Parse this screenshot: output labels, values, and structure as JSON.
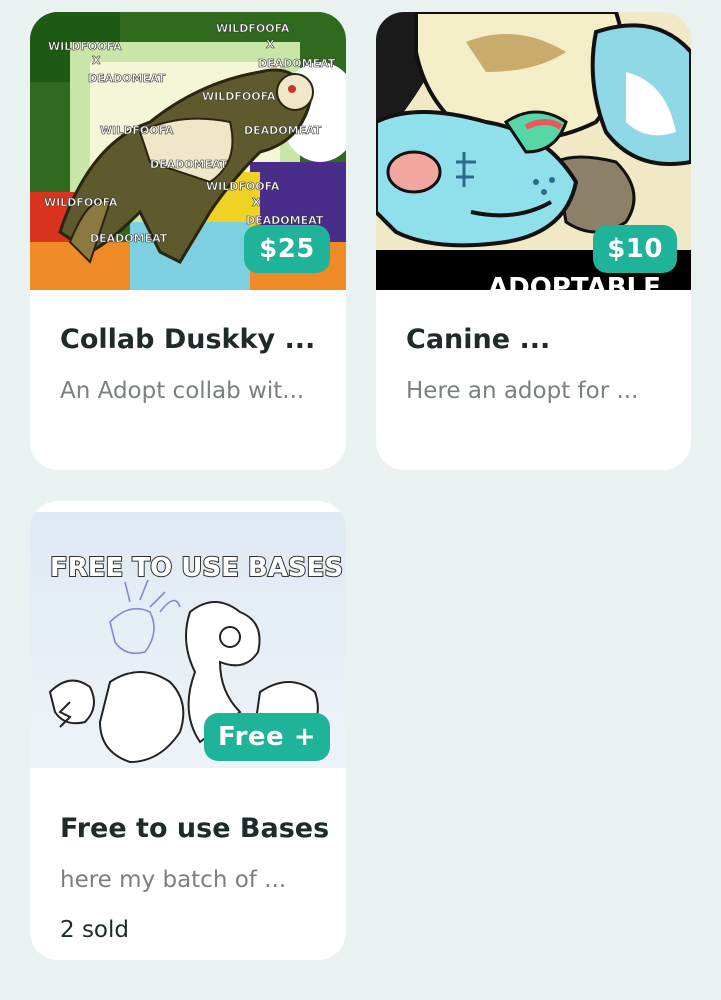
{
  "listings": [
    {
      "image_alt": "Collab adopt artwork with WILDFOOFA x DEADOMEAT watermarks",
      "watermark_text": "WILDFOOFA X DEADOMEAT",
      "price": "$25",
      "title": "Collab Duskky ...",
      "description": "An Adopt collab wit..."
    },
    {
      "image_alt": "Canine adoptable artwork",
      "banner_text": "ADOPTABLE",
      "price": "$10",
      "title": "Canine ...",
      "description": "Here an adopt for ..."
    },
    {
      "image_alt": "Free to use bases line art",
      "banner_text": "FREE TO USE BASES",
      "price": "Free +",
      "title": "Free to use Bases",
      "description": "here my batch of ...",
      "sold": "2 sold"
    }
  ],
  "colors": {
    "page_background": "#e9f1f1",
    "card_background": "#ffffff",
    "price_badge": "#1fb39a",
    "title_text": "#1f2a2a",
    "description_text": "#7a8080"
  }
}
